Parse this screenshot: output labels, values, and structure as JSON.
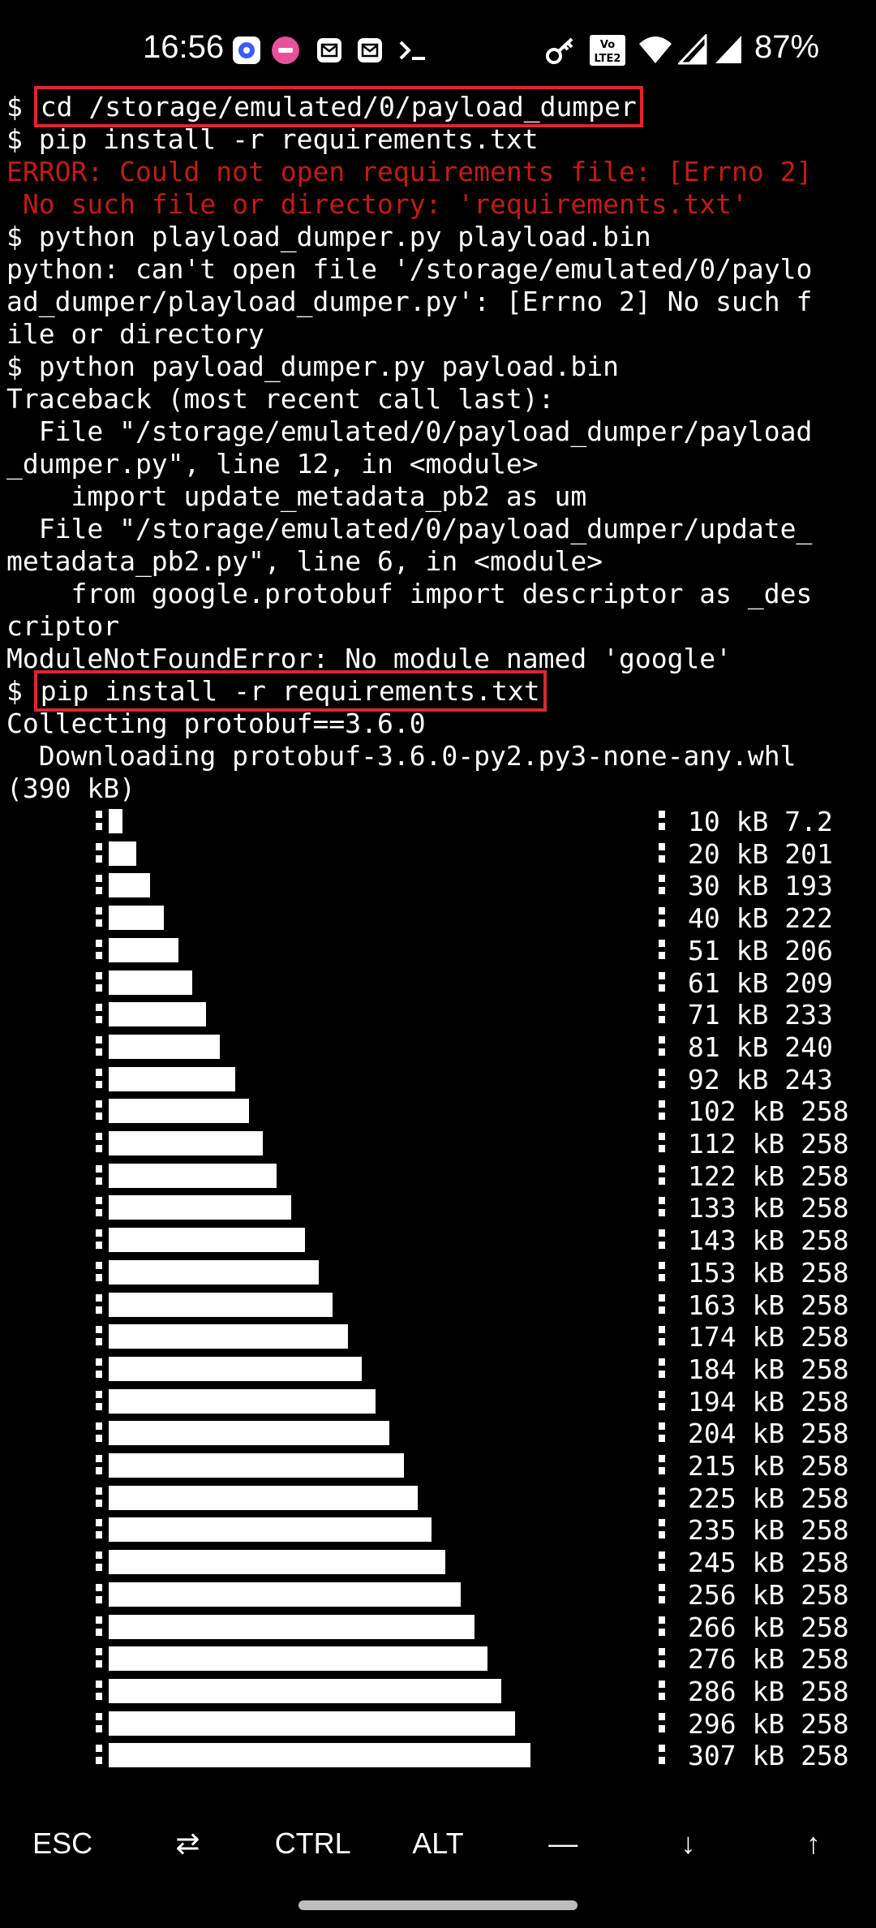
{
  "status_bar": {
    "time": "16:56",
    "notifications": [
      "app-circle-icon",
      "app-pink-icon",
      "mail-icon",
      "mail-icon",
      "terminal-icon"
    ],
    "system_icons": [
      "key-icon",
      "volte-lte2-icon",
      "wifi-icon",
      "signal-icon",
      "signal-icon"
    ],
    "volte_label": "Vo LTE2",
    "battery": "87%"
  },
  "terminal": {
    "colors": {
      "error": "#c21b17",
      "highlight_box": "#e0262b"
    },
    "lines": [
      {
        "prompt": "$ ",
        "text": "cd /storage/emulated/0/payload_dumper",
        "highlight": true
      },
      {
        "prompt": "$ ",
        "text": "pip install -r requirements.txt"
      },
      {
        "text": "ERROR: Could not open requirements file: [Errno 2]",
        "error": true
      },
      {
        "text": " No such file or directory: 'requirements.txt'",
        "error": true
      },
      {
        "prompt": "$ ",
        "text": "python playload_dumper.py playload.bin"
      },
      {
        "text": "python: can't open file '/storage/emulated/0/paylo"
      },
      {
        "text": "ad_dumper/playload_dumper.py': [Errno 2] No such f"
      },
      {
        "text": "ile or directory"
      },
      {
        "prompt": "$ ",
        "text": "python payload_dumper.py payload.bin"
      },
      {
        "text": "Traceback (most recent call last):"
      },
      {
        "text": "  File \"/storage/emulated/0/payload_dumper/payload"
      },
      {
        "text": "_dumper.py\", line 12, in <module>"
      },
      {
        "text": "    import update_metadata_pb2 as um"
      },
      {
        "text": "  File \"/storage/emulated/0/payload_dumper/update_"
      },
      {
        "text": "metadata_pb2.py\", line 6, in <module>"
      },
      {
        "text": "    from google.protobuf import descriptor as _des"
      },
      {
        "text": "criptor"
      },
      {
        "text": "ModuleNotFoundError: No module named 'google'"
      },
      {
        "prompt": "$ ",
        "text": "pip install -r requirements.txt",
        "highlight": true
      },
      {
        "text": "Collecting protobuf==3.6.0"
      },
      {
        "text": "  Downloading protobuf-3.6.0-py2.py3-none-any.whl"
      },
      {
        "text": "(390 kB)"
      }
    ],
    "progress_total_kb": 390,
    "progress_rows": [
      {
        "size": "10 kB 7.2",
        "kb": 10
      },
      {
        "size": "20 kB 201",
        "kb": 20
      },
      {
        "size": "30 kB 193",
        "kb": 30
      },
      {
        "size": "40 kB 222",
        "kb": 40
      },
      {
        "size": "51 kB 206",
        "kb": 51
      },
      {
        "size": "61 kB 209",
        "kb": 61
      },
      {
        "size": "71 kB 233",
        "kb": 71
      },
      {
        "size": "81 kB 240",
        "kb": 81
      },
      {
        "size": "92 kB 243",
        "kb": 92
      },
      {
        "size": "102 kB 258",
        "kb": 102
      },
      {
        "size": "112 kB 258",
        "kb": 112
      },
      {
        "size": "122 kB 258",
        "kb": 122
      },
      {
        "size": "133 kB 258",
        "kb": 133
      },
      {
        "size": "143 kB 258",
        "kb": 143
      },
      {
        "size": "153 kB 258",
        "kb": 153
      },
      {
        "size": "163 kB 258",
        "kb": 163
      },
      {
        "size": "174 kB 258",
        "kb": 174
      },
      {
        "size": "184 kB 258",
        "kb": 184
      },
      {
        "size": "194 kB 258",
        "kb": 194
      },
      {
        "size": "204 kB 258",
        "kb": 204
      },
      {
        "size": "215 kB 258",
        "kb": 215
      },
      {
        "size": "225 kB 258",
        "kb": 225
      },
      {
        "size": "235 kB 258",
        "kb": 235
      },
      {
        "size": "245 kB 258",
        "kb": 245
      },
      {
        "size": "256 kB 258",
        "kb": 256
      },
      {
        "size": "266 kB 258",
        "kb": 266
      },
      {
        "size": "276 kB 258",
        "kb": 276
      },
      {
        "size": "286 kB 258",
        "kb": 286
      },
      {
        "size": "296 kB 258",
        "kb": 296
      },
      {
        "size": "307 kB 258",
        "kb": 307
      }
    ]
  },
  "extra_keys": [
    {
      "label": "ESC",
      "name": "esc-key"
    },
    {
      "label": "⇄",
      "name": "tab-key"
    },
    {
      "label": "CTRL",
      "name": "ctrl-key"
    },
    {
      "label": "ALT",
      "name": "alt-key"
    },
    {
      "label": "—",
      "name": "dash-key"
    },
    {
      "label": "↓",
      "name": "down-arrow-key"
    },
    {
      "label": "↑",
      "name": "up-arrow-key"
    }
  ]
}
